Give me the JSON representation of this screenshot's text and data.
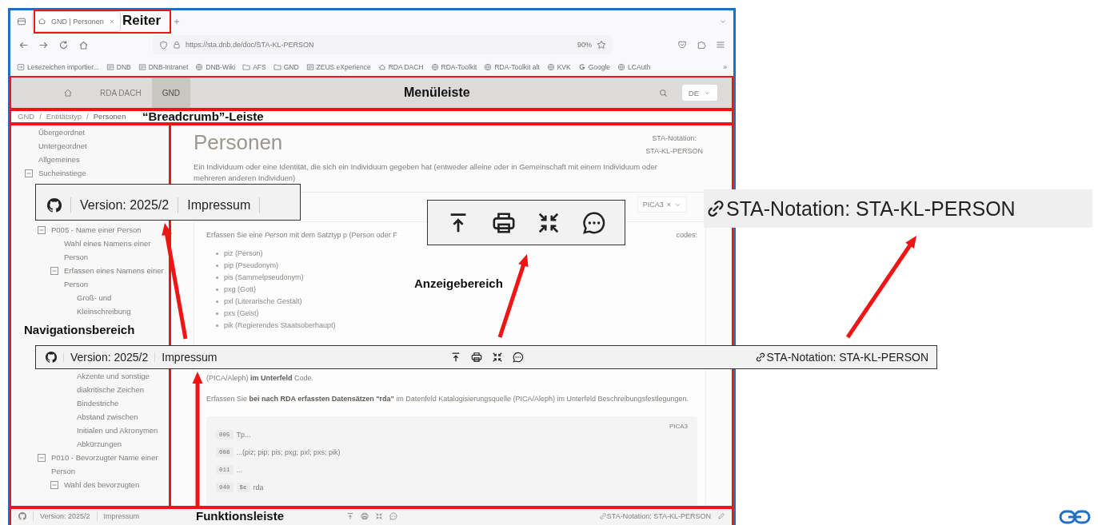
{
  "browser": {
    "tabs": [
      {
        "label": "GND | Personen",
        "selected": true
      }
    ],
    "url": "https://sta.dnb.de/doc/STA-KL-PERSON",
    "zoom": "90%",
    "bookmarks": [
      {
        "kind": "import",
        "label": "Lesezeichen importier..."
      },
      {
        "kind": "logo",
        "label": "DNB"
      },
      {
        "kind": "logo",
        "label": "DNB-Intranet"
      },
      {
        "kind": "globe",
        "label": "DNB-Wiki"
      },
      {
        "kind": "folder",
        "label": "AFS"
      },
      {
        "kind": "folder",
        "label": "GND"
      },
      {
        "kind": "logo",
        "label": "ZEUS eXperience"
      },
      {
        "kind": "roof",
        "label": "RDA DACH"
      },
      {
        "kind": "globe",
        "label": "RDA-Toolkit"
      },
      {
        "kind": "globe",
        "label": "RDA-Toolkit alt"
      },
      {
        "kind": "globe",
        "label": "KVK"
      },
      {
        "kind": "google",
        "label": "Google"
      },
      {
        "kind": "globe",
        "label": "LCAuth"
      }
    ],
    "overflow": "»"
  },
  "menubar": {
    "items": [
      {
        "kind": "home",
        "selected": false
      },
      {
        "kind": "text",
        "label": "RDA DACH",
        "selected": false
      },
      {
        "kind": "text",
        "label": "GND",
        "selected": true
      }
    ],
    "language": "DE"
  },
  "breadcrumb": {
    "items": [
      "GND",
      "Entitätstyp",
      "Personen"
    ],
    "separators": [
      "/",
      "/"
    ]
  },
  "navigation": {
    "items": [
      {
        "label": "Übergeordnet"
      },
      {
        "label": "Untergeordnet"
      },
      {
        "label": "Allgemeines"
      },
      {
        "label": "Sucheinstiege",
        "expanded": true,
        "children": [
          {
            "label": "P005 - Name einer Person",
            "expanded": true,
            "children": [
              {
                "label": "Wahl eines Namens einer Person"
              },
              {
                "label": "Erfassen eines Namens einer Person",
                "expanded": true,
                "children": [
                  {
                    "label": "Groß- und Kleinschreibung"
                  },
                  {
                    "label": "Akzente und sonstige diakritische Zeichen"
                  },
                  {
                    "label": "Bindestriche"
                  },
                  {
                    "label": "Abstand zwischen Initialen und Akronymen"
                  },
                  {
                    "label": "Abkürzungen"
                  }
                ]
              }
            ]
          },
          {
            "label": "P010 - Bevorzugter Name einer Person",
            "expanded": true,
            "children": [
              {
                "label": "Wahl des bevorzugten",
                "expanded": true
              }
            ]
          }
        ]
      }
    ]
  },
  "document": {
    "title": "Personen",
    "notation_label": "STA-Notation:",
    "notation": "STA-KL-PERSON",
    "intro": "Ein Individuum oder eine Identität, die sich ein Individuum gegeben hat (entweder alleine oder in Gemeinschaft mit einem Individuum oder mehreren anderen Individuen)",
    "format": "PICA3",
    "format_clear": "×",
    "instruction_start": "Erfassen Sie eine *Person* mit dem Satztyp p (Person oder F",
    "instruction_end": "codes:",
    "codes": [
      "piz (Person)",
      "pip (Pseudonym)",
      "pis (Sammelpseudonym)",
      "pxg (Gott)",
      "pxl (Literarische Gestalt)",
      "pxs (Geist)",
      "pik (Regierendes Staatsoberhaupt)"
    ],
    "note": "(PICA/Aleph) **im Unterfeld** Code.",
    "rda_note": "Erfassen Sie **bei nach RDA erfassten Datensätzen \"rda\"** im Datenfeld Katalogisierungsquelle (PICA/Aleph) im Unterfeld Beschreibungsfestlegungen.",
    "example": {
      "label": "PICA3",
      "lines": [
        {
          "field": "005",
          "text": "Tp..."
        },
        {
          "field": "008",
          "text": "...(piz; pip; pis; pxg; pxl; pxs; pik)"
        },
        {
          "field": "011",
          "text": "..."
        },
        {
          "field": "040",
          "subfield": "$e",
          "text": "rda"
        }
      ]
    }
  },
  "footer": {
    "version": "Version: 2025/2",
    "imprint": "Impressum",
    "notation": "STA-Notation: STA-KL-PERSON"
  },
  "annotations": {
    "labels": [
      "Reiter",
      "Menüleiste",
      "“Breadcrumb”-Leiste",
      "Navigationsbereich",
      "Anzeigebereich",
      "Funktionsleiste"
    ],
    "callouts": [
      {
        "kind": "links",
        "version": "Version: 2025/2",
        "imprint": "Impressum"
      },
      {
        "kind": "tools"
      },
      {
        "kind": "notation",
        "notation": "STA-Notation: STA-KL-PERSON"
      },
      {
        "kind": "bar",
        "version": "Version: 2025/2",
        "imprint": "Impressum",
        "notation": "STA-Notation: STA-KL-PERSON"
      }
    ]
  }
}
